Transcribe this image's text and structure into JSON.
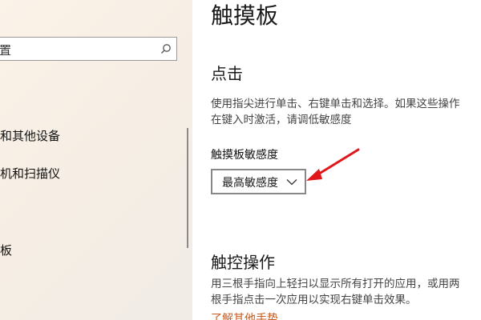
{
  "sidebar": {
    "search_text": "置",
    "items": [
      {
        "label": "和其他设备"
      },
      {
        "label": "机和扫描仪"
      },
      {
        "label": "板"
      }
    ]
  },
  "main": {
    "title": "触摸板",
    "tap_section": {
      "heading": "点击",
      "description_line1": "使用指尖进行单击、右键单击和选择。如果这些操作",
      "description_line2": "在键入时激活，请调低敏感度",
      "sensitivity_label": "触摸板敏感度",
      "sensitivity_value": "最高敏感度"
    },
    "gesture_section": {
      "heading": "触控操作",
      "description_line1": "用三根手指向上轻扫以显示所有打开的应用，或用两",
      "description_line2": "根手指点击一次应用以实现右键单击效果。",
      "link_text": "了解其他手势"
    }
  },
  "colors": {
    "annotation_arrow": "#e0161b",
    "link": "#c75a1c"
  }
}
